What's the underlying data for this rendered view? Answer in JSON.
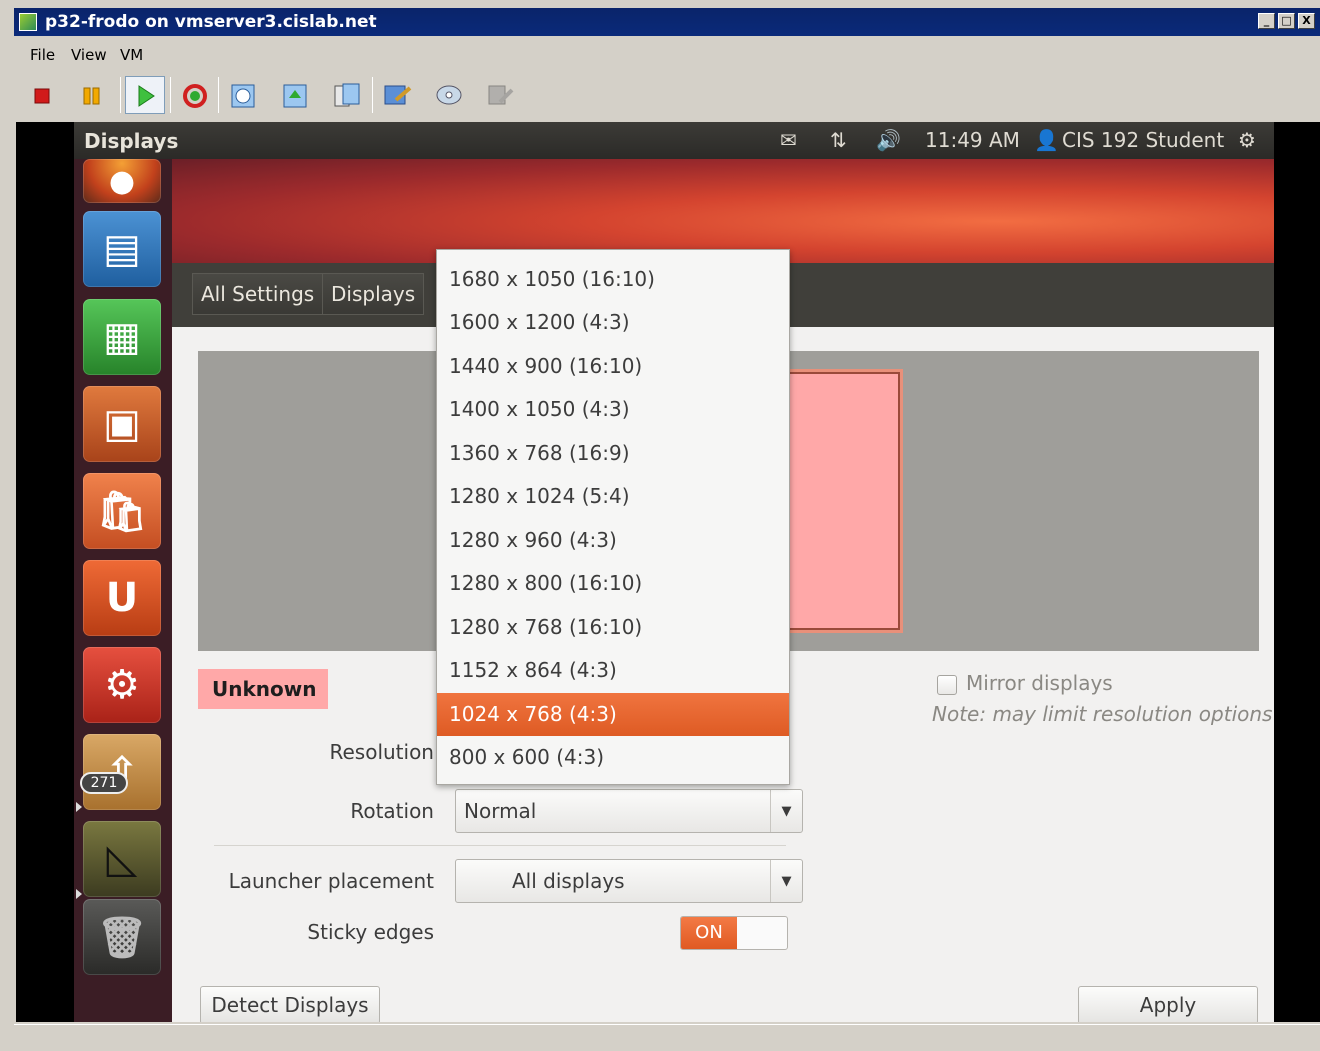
{
  "window": {
    "title": "p32-frodo on vmserver3.cislab.net",
    "buttons": [
      "_",
      "□",
      "X"
    ]
  },
  "menu": [
    "File",
    "View",
    "VM"
  ],
  "toolbar": {
    "icons": [
      "stop-icon",
      "pause-icon",
      "play-icon",
      "reset-icon",
      "snapshot-icon",
      "revert-snapshot-icon",
      "snapshot-manager-icon",
      "edit-settings-icon",
      "cd-dvd-icon",
      "floppy-icon"
    ],
    "colors": {
      "stop": "#d11a1a",
      "pause": "#f2a900",
      "play": "#2faa2f",
      "reset": "#d02020"
    }
  },
  "panel": {
    "title": "Displays",
    "time": "11:49 AM",
    "user": "CIS 192 Student",
    "icons": [
      "mail-icon",
      "network-icon",
      "volume-icon",
      "user-icon",
      "gear-icon"
    ]
  },
  "launcher": {
    "items": [
      {
        "name": "firefox",
        "color": "#e8731f"
      },
      {
        "name": "writer",
        "color": "#2d77b7"
      },
      {
        "name": "calc",
        "color": "#3da740"
      },
      {
        "name": "impress",
        "color": "#c85a24"
      },
      {
        "name": "software-center",
        "color": "#e2673a"
      },
      {
        "name": "ubuntu-one",
        "color": "#d94e1f"
      },
      {
        "name": "system-settings",
        "color": "#d83c2d"
      },
      {
        "name": "update-manager",
        "color": "#c79149"
      },
      {
        "name": "workspaces",
        "color": "#6b6a3a"
      },
      {
        "name": "trash",
        "color": "#4a4a48"
      }
    ],
    "badge": "271"
  },
  "nav": {
    "all_settings": "All Settings",
    "displays": "Displays"
  },
  "display_label": "Unknown",
  "resolution": {
    "label": "Resolution",
    "options": [
      "1680 x 1050 (16:10)",
      "1600 x 1200 (4:3)",
      "1440 x 900 (16:10)",
      "1400 x 1050 (4:3)",
      "1360 x 768 (16:9)",
      "1280 x 1024 (5:4)",
      "1280 x 960 (4:3)",
      "1280 x 800 (16:10)",
      "1280 x 768 (16:10)",
      "1152 x 864 (4:3)",
      "1024 x 768 (4:3)",
      "800 x 600 (4:3)"
    ],
    "selected": "1024 x 768 (4:3)"
  },
  "rotation": {
    "label": "Rotation",
    "value": "Normal"
  },
  "launcher_placement": {
    "label": "Launcher placement",
    "value": "All displays"
  },
  "sticky_edges": {
    "label": "Sticky edges",
    "state": "ON"
  },
  "mirror": {
    "label": "Mirror displays",
    "note": "Note: may limit resolution options",
    "checked": false
  },
  "buttons": {
    "detect": "Detect Displays",
    "apply": "Apply"
  },
  "colors": {
    "accent": "#e05a22",
    "monitor": "#ffa8a8",
    "launcher_bg": "#3b1d25",
    "panel_bg": "#3c3b37"
  }
}
